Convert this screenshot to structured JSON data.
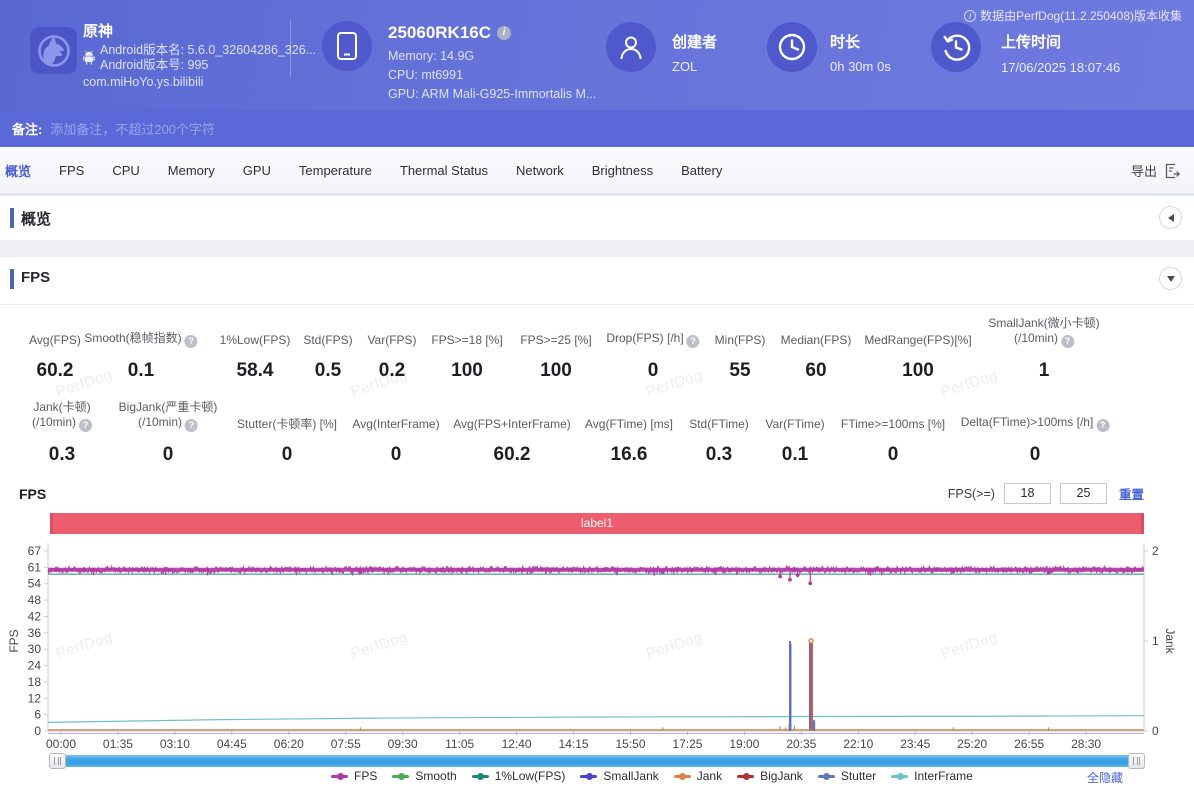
{
  "header": {
    "collect_info": "数据由PerfDog(11.2.250408)版本收集",
    "app": {
      "name": "原神",
      "version_name_line": "Android版本名: 5.6.0_32604286_326...",
      "version_code_line": "Android版本号: 995",
      "package": "com.miHoYo.ys.bilibili"
    },
    "device": {
      "name": "25060RK16C",
      "memory_line": "Memory: 14.9G",
      "cpu_line": "CPU: mt6991",
      "gpu_line": "GPU: ARM Mali-G925-Immortalis M..."
    },
    "creator": {
      "label": "创建者",
      "value": "ZOL"
    },
    "duration": {
      "label": "时长",
      "value": "0h 30m 0s"
    },
    "upload": {
      "label": "上传时间",
      "value": "17/06/2025 18:07:46"
    }
  },
  "note_bar": {
    "label": "备注:",
    "placeholder": "添加备注，不超过200个字符"
  },
  "tab_bar": {
    "tabs": [
      "概览",
      "FPS",
      "CPU",
      "Memory",
      "GPU",
      "Temperature",
      "Thermal Status",
      "Network",
      "Brightness",
      "Battery"
    ],
    "active_tab": "概览",
    "export_label": "导出"
  },
  "sections": {
    "overview_title": "概览",
    "fps_title": "FPS"
  },
  "watermark_text": "PerfDog",
  "stats": {
    "row1": [
      {
        "label": "Avg(FPS)",
        "value": "60.2"
      },
      {
        "label": "Smooth(稳帧指数)",
        "help": true,
        "value": "0.1"
      },
      {
        "label": "1%Low(FPS)",
        "value": "58.4"
      },
      {
        "label": "Std(FPS)",
        "value": "0.5"
      },
      {
        "label": "Var(FPS)",
        "value": "0.2"
      },
      {
        "label": "FPS>=18 [%]",
        "value": "100"
      },
      {
        "label": "FPS>=25 [%]",
        "value": "100"
      },
      {
        "label": "Drop(FPS) [/h]",
        "help": true,
        "value": "0"
      },
      {
        "label": "Min(FPS)",
        "value": "55"
      },
      {
        "label": "Median(FPS)",
        "value": "60"
      },
      {
        "label": "MedRange(FPS)[%]",
        "value": "100"
      },
      {
        "label": "SmallJank(微小卡顿)",
        "label2": "(/10min)",
        "help": true,
        "value": "1"
      }
    ],
    "row2": [
      {
        "label": "Jank(卡顿)",
        "label2": "(/10min)",
        "help": true,
        "value": "0.3"
      },
      {
        "label": "BigJank(严重卡顿)",
        "label2": "(/10min)",
        "help": true,
        "value": "0"
      },
      {
        "label": "Stutter(卡顿率) [%]",
        "value": "0"
      },
      {
        "label": "Avg(InterFrame)",
        "value": "0"
      },
      {
        "label": "Avg(FPS+InterFrame)",
        "value": "60.2"
      },
      {
        "label": "Avg(FTime) [ms]",
        "value": "16.6"
      },
      {
        "label": "Std(FTime)",
        "value": "0.3"
      },
      {
        "label": "Var(FTime)",
        "value": "0.1"
      },
      {
        "label": "FTime>=100ms [%]",
        "value": "0"
      },
      {
        "label": "Delta(FTime)>100ms [/h]",
        "help": true,
        "value": "0"
      }
    ]
  },
  "chart_controls": {
    "title": "FPS",
    "threshold_label": "FPS(>=)",
    "input1": "18",
    "input2": "25",
    "reset_label": "重置"
  },
  "chart_data": {
    "type": "line",
    "title": "FPS",
    "annotation_label": "label1",
    "x_axis": {
      "tick_labels": [
        "00:00",
        "01:35",
        "03:10",
        "04:45",
        "06:20",
        "07:55",
        "09:30",
        "11:05",
        "12:40",
        "14:15",
        "15:50",
        "17:25",
        "19:00",
        "20:35",
        "22:10",
        "23:45",
        "25:20",
        "26:55",
        "28:30"
      ],
      "tick_interval_seconds": 95,
      "total_seconds": 1800
    },
    "y_axis_left": {
      "title": "FPS",
      "tick_labels": [
        0,
        6,
        12,
        18,
        24,
        30,
        36,
        42,
        48,
        54,
        61,
        67
      ],
      "max": 67
    },
    "y_axis_right": {
      "title": "Jank",
      "tick_labels": [
        0,
        1,
        2
      ],
      "max": 2
    },
    "grid": false,
    "legend_position": "bottom",
    "legend_toggle_label": "全隐藏",
    "series": [
      {
        "name": "InterFrame",
        "color": "#6fc0c9",
        "axis": "left",
        "kind": "points",
        "points": [
          [
            0,
            3.2
          ],
          [
            0.15,
            4.2
          ],
          [
            0.3,
            4.8
          ],
          [
            0.5,
            5.2
          ],
          [
            0.7,
            5.4
          ],
          [
            0.85,
            5.5
          ],
          [
            1,
            5.7
          ]
        ]
      },
      {
        "name": "Smooth",
        "color": "#4cab52",
        "axis": "left",
        "kind": "flat",
        "value": 0.4
      },
      {
        "name": "1%Low(FPS)",
        "color": "#1b8a78",
        "axis": "left",
        "kind": "flat",
        "value": 58.4
      },
      {
        "name": "SmallJank",
        "color": "#4b44c8",
        "axis": "right",
        "kind": "spikes",
        "below_axis_line": true,
        "spikes": [
          {
            "x": 0.677,
            "v": 1,
            "w": 1.6
          },
          {
            "x": 0.6955,
            "v": 1,
            "w": 2.2
          }
        ]
      },
      {
        "name": "BigJank",
        "color": "#b23230",
        "axis": "right",
        "kind": "spikes",
        "spikes": [
          {
            "x": 0.6972,
            "v": 1,
            "w": 1.3
          }
        ]
      },
      {
        "name": "Jank",
        "color": "#dd8144",
        "axis": "right",
        "kind": "spikes",
        "dot_on_top": true,
        "spikes": [
          {
            "x": 0.285,
            "v": 0.04
          },
          {
            "x": 0.561,
            "v": 0.04
          },
          {
            "x": 0.668,
            "v": 0.05
          },
          {
            "x": 0.673,
            "v": 0.04
          },
          {
            "x": 0.681,
            "v": 0.06
          },
          {
            "x": 0.6962,
            "v": 1,
            "w": 1.1
          },
          {
            "x": 0.826,
            "v": 0.04
          },
          {
            "x": 0.913,
            "v": 0.04
          }
        ]
      },
      {
        "name": "Stutter",
        "color": "#5f7ab8",
        "axis": "right",
        "kind": "spikes",
        "spikes": [
          {
            "x": 0.6778,
            "v": 0.97,
            "w": 1.2
          },
          {
            "x": 0.677,
            "v": 0.07,
            "w": 3
          },
          {
            "x": 0.699,
            "v": 0.12,
            "w": 2.2
          }
        ]
      },
      {
        "name": "FPS",
        "color": "#b23aa5",
        "axis": "left",
        "kind": "noisy-line",
        "baseline": 60.2,
        "noise_low": -1.35,
        "noise_high": 1.05,
        "dips": [
          {
            "x": 0.285,
            "v": 59
          },
          {
            "x": 0.561,
            "v": 59.2
          },
          {
            "x": 0.668,
            "v": 57.5
          },
          {
            "x": 0.677,
            "v": 56.3
          },
          {
            "x": 0.684,
            "v": 58
          },
          {
            "x": 0.6955,
            "v": 55
          },
          {
            "x": 0.826,
            "v": 59.4
          },
          {
            "x": 0.913,
            "v": 58.9
          }
        ]
      }
    ],
    "legend_order": [
      "FPS",
      "Smooth",
      "1%Low(FPS)",
      "SmallJank",
      "Jank",
      "BigJank",
      "Stutter",
      "InterFrame"
    ]
  }
}
